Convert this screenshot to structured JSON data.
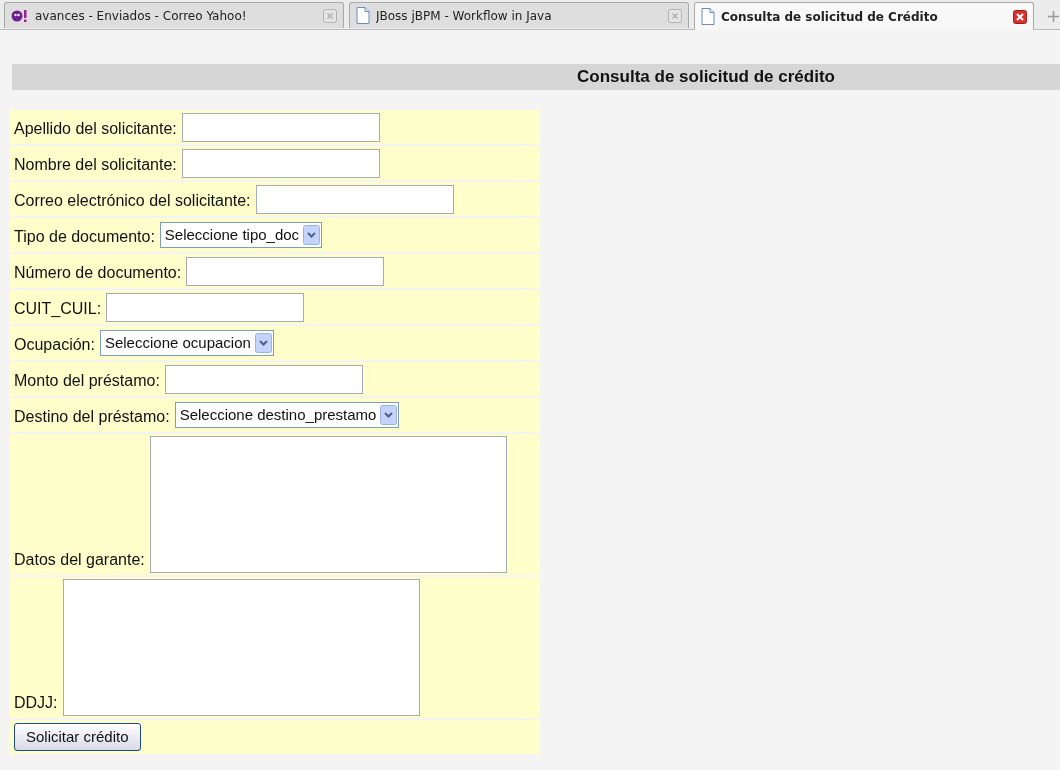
{
  "tabs": [
    {
      "label": "avances - Enviados - Correo Yahoo!",
      "selected": false,
      "kind": "site"
    },
    {
      "label": "JBoss jBPM - Workflow in Java",
      "selected": false,
      "kind": "document"
    },
    {
      "label": "Consulta de solicitud de Crédito",
      "selected": true,
      "kind": "document"
    }
  ],
  "page_title": "Consulta de solicitud de crédito",
  "form": {
    "fields": [
      {
        "label": "Apellido del solicitante:",
        "kind": "text"
      },
      {
        "label": "Nombre del solicitante:",
        "kind": "text"
      },
      {
        "label": "Correo electrónico del solicitante:",
        "kind": "text"
      },
      {
        "label": "Tipo de documento:",
        "kind": "select",
        "value": "Seleccione tipo_doc"
      },
      {
        "label": "Número de documento:",
        "kind": "text"
      },
      {
        "label": "CUIT_CUIL:",
        "kind": "text"
      },
      {
        "label": "Ocupación:",
        "kind": "select",
        "value": "Seleccione ocupacion"
      },
      {
        "label": "Monto del préstamo:",
        "kind": "text"
      },
      {
        "label": "Destino del préstamo:",
        "kind": "select",
        "value": "Seleccione destino_prestamo"
      },
      {
        "label": "Datos del garante:",
        "kind": "textarea"
      },
      {
        "label": "DDJJ:",
        "kind": "textarea"
      }
    ],
    "submit": "Solicitar crédito"
  }
}
